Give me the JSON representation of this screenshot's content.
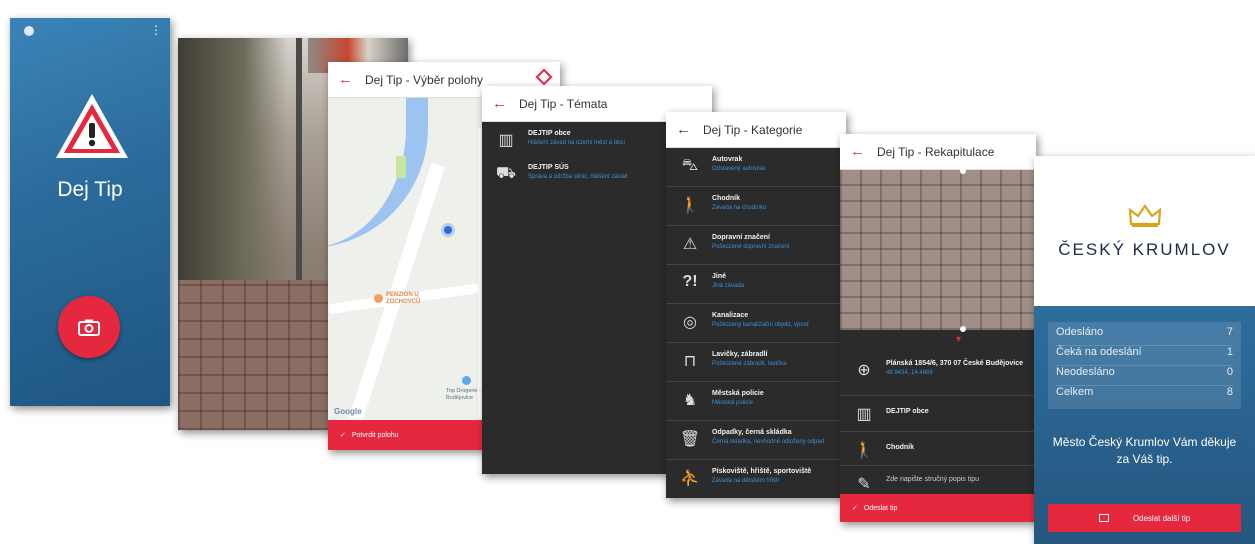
{
  "splash": {
    "app_name": "Dej Tip"
  },
  "location": {
    "title": "Dej Tip - Výběr polohy",
    "map_labels": [
      "PENZION U ZOCHOVCŮ",
      "Top Drogerie - České Budějovice",
      "Google"
    ],
    "confirm_label": "Potvrdit polohu"
  },
  "topics": {
    "title": "Dej Tip - Témata",
    "items": [
      {
        "title": "DEJTIP obce",
        "subtitle": "Hlášení závad na území měst a obcí"
      },
      {
        "title": "DEJTIP SÚS",
        "subtitle": "Správa a údržba silnic, hlášení závad"
      }
    ]
  },
  "categories": {
    "title": "Dej Tip - Kategorie",
    "items": [
      {
        "title": "Autovrak",
        "subtitle": "Odstavený autovrak"
      },
      {
        "title": "Chodník",
        "subtitle": "Závada na chodníku"
      },
      {
        "title": "Dopravní značení",
        "subtitle": "Poškozené dopravní značení"
      },
      {
        "title": "Jiné",
        "subtitle": "Jiná závada"
      },
      {
        "title": "Kanalizace",
        "subtitle": "Poškozený kanalizační objekt, vpusť"
      },
      {
        "title": "Lavičky, zábradlí",
        "subtitle": "Poškozené zábradlí, lavička"
      },
      {
        "title": "Městská policie",
        "subtitle": "Městská policie"
      },
      {
        "title": "Odpadky, černá skládka",
        "subtitle": "Černá skládka, nevhodně odložený odpad"
      },
      {
        "title": "Pískoviště, hřiště, sportoviště",
        "subtitle": "Závada na dětském hřišti"
      }
    ]
  },
  "summary": {
    "title": "Dej Tip - Rekapitulace",
    "address": "Plánská 1854/6, 370 07 České Budějovice",
    "coords": "48.9434, 14.4668",
    "topic": "DEJTIP obce",
    "category": "Chodník",
    "description_placeholder": "Zde napište stručný popis tipu",
    "send_label": "Odeslat tip"
  },
  "thanks": {
    "city_name": "ČESKÝ KRUMLOV",
    "stats": [
      {
        "label": "Odesláno",
        "value": "7"
      },
      {
        "label": "Čeká na odeslání",
        "value": "1"
      },
      {
        "label": "Neodesláno",
        "value": "0"
      },
      {
        "label": "Celkem",
        "value": "8"
      }
    ],
    "message": "Město Český Krumlov Vám děkuje za Váš tip.",
    "send_another_label": "Odeslat další tip"
  },
  "colors": {
    "accent_red": "#e5283e",
    "link_blue": "#3b8fd6",
    "splash_blue": "#2a6a9a",
    "dark_bg": "#2b2b2b"
  }
}
